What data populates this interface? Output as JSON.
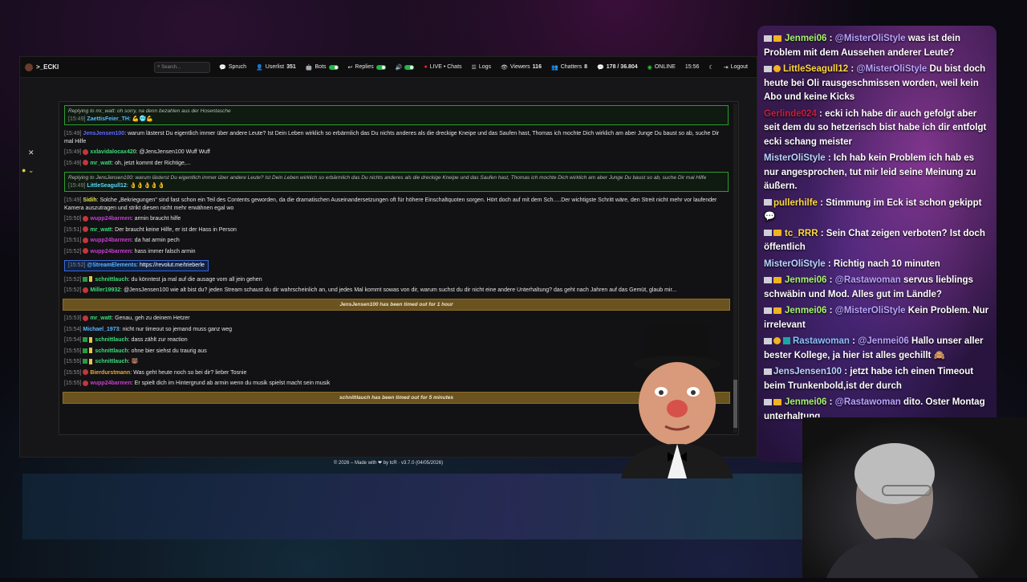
{
  "nav": {
    "brand": ">_ECKI",
    "search_placeholder": "Search...",
    "items": [
      {
        "label": "Spruch"
      },
      {
        "label": "Userlist",
        "count": "351"
      },
      {
        "label": "Bots"
      },
      {
        "label": "Replies"
      },
      {
        "label": "LIVE • Chats"
      },
      {
        "label": "Logs"
      },
      {
        "label": "Viewers",
        "count": "116"
      },
      {
        "label": "Chatters",
        "count": "8"
      },
      {
        "label": "178 / 36.804"
      },
      {
        "label": "ONLINE"
      },
      {
        "label": "15:56"
      },
      {
        "label": "Logout"
      }
    ]
  },
  "chat": [
    {
      "type": "reply",
      "ref": "Replying to mr_watt: oh sorry, na denn bezahlen aus der Hosentasche",
      "ts": "[15:49]",
      "user": "ZaettisFeier_TH",
      "user_color": "#58b8ff",
      "text": "💪🥶💪"
    },
    {
      "type": "msg",
      "ts": "[15:49]",
      "user": "JensJensen100",
      "user_color": "#5a6bff",
      "text": "warum lästerst Du eigentlich immer über andere Leute? Ist Dein Leben wirklich so erbärmlich das Du nichts anderes als die dreckige Kneipe und das Saufen hast, Thomas ich mochte Dich wirklich am aber Junge Du baust so ab, suche Dir mal Hilfe"
    },
    {
      "type": "msg",
      "ts": "[15:49]",
      "user": "xxlavidalocax420",
      "user_color": "#3ddc7a",
      "badge": true,
      "text": "@JensJensen100 Wuff Wuff"
    },
    {
      "type": "msg",
      "ts": "[15:49]",
      "user": "mr_watt",
      "user_color": "#3ddc7a",
      "badge": true,
      "text": "oh, jetzt kommt der Richtige,..."
    },
    {
      "type": "reply",
      "ref": "Replying to JensJensen100: warum lästerst Du eigentlich immer über andere Leute? Ist Dein Leben wirklich so erbärmlich das Du nichts anderes als die dreckige Kneipe und das Saufen hast, Thomas ich mochte Dich wirklich am aber Junge Du baust so ab, suche Dir mal Hilfe",
      "ts": "[15:49]",
      "user": "LittleSeagull12",
      "user_color": "#58d8ff",
      "text": "👌👌👌👌👌"
    },
    {
      "type": "msg",
      "ts": "[15:49]",
      "user": "Sidih",
      "user_color": "#e6e64a",
      "text": "Solche „Bekriegungen\" sind fast schon ein Teil des Contents geworden, da die dramatischen Auseinandersetzungen oft für höhere Einschaltquoten sorgen. Hört doch auf mit dem Sch.....Der wichtigste Schritt wäre, den Streit nicht mehr vor laufender Kamera auszutragen und strikt diesen nicht mehr erwähnen egal wo"
    },
    {
      "type": "msg",
      "ts": "[15:50]",
      "user": "wupp24barmen",
      "user_color": "#c43fd0",
      "badge": true,
      "text": "armin braucht hilfe"
    },
    {
      "type": "msg",
      "ts": "[15:51]",
      "user": "mr_watt",
      "user_color": "#3ddc7a",
      "badge": true,
      "text": "Der braucht keine Hilfe, er ist der Hass in Person"
    },
    {
      "type": "msg",
      "ts": "[15:51]",
      "user": "wupp24barmen",
      "user_color": "#c43fd0",
      "badge": true,
      "text": "da hat armin pech"
    },
    {
      "type": "msg",
      "ts": "[15:52]",
      "user": "wupp24barmen",
      "user_color": "#c43fd0",
      "badge": true,
      "text": "hass immer falsch armin"
    },
    {
      "type": "se",
      "ts": "[15:52]",
      "user": "@StreamElements",
      "user_color": "#58b8ff",
      "text": "https://revolut.me/trieberle"
    },
    {
      "type": "msg",
      "ts": "[15:52]",
      "user": "schnittlauch",
      "user_color": "#3ddc7a",
      "mod": true,
      "text": "du könntest ja mal auf die ausage vom all jein gehen"
    },
    {
      "type": "msg",
      "ts": "[15:52]",
      "user": "Miller19932",
      "user_color": "#3ddc7a",
      "badge": true,
      "text": "@JensJensen100 wie alt bist du? jeden Stream schaust du dir wahrscheinlich an, und jedes Mal kommt sowas von dir, warum suchst du dir nicht eine andere Unterhaltung? das geht nach Jahren auf das Gemüt, glaub mir..."
    },
    {
      "type": "timeout",
      "text": "JensJensen100 has been timed out for 1 hour"
    },
    {
      "type": "msg",
      "ts": "[15:53]",
      "user": "mr_watt",
      "user_color": "#3ddc7a",
      "badge": true,
      "text": "Genau, geh zu deinem Hetzer"
    },
    {
      "type": "msg",
      "ts": "[15:54]",
      "user": "Michael_1973",
      "user_color": "#58b8ff",
      "text": "nicht nur timeout so jemand muss ganz weg"
    },
    {
      "type": "msg",
      "ts": "[15:54]",
      "user": "schnittlauch",
      "user_color": "#3ddc7a",
      "mod": true,
      "text": "dass zählt zur reaction"
    },
    {
      "type": "msg",
      "ts": "[15:55]",
      "user": "schnittlauch",
      "user_color": "#3ddc7a",
      "mod": true,
      "text": "ohne bier siehst du traurig aus"
    },
    {
      "type": "msg",
      "ts": "[15:55]",
      "user": "schnittlauch",
      "user_color": "#3ddc7a",
      "mod": true,
      "text": "🐻"
    },
    {
      "type": "msg",
      "ts": "[15:55]",
      "user": "Bierdurstmann",
      "user_color": "#e6a83a",
      "badge": true,
      "text": "Was geht heute noch so bei dir? lieber Tosnie"
    },
    {
      "type": "msg",
      "ts": "[15:55]",
      "user": "wupp24barmen",
      "user_color": "#c43fd0",
      "badge": true,
      "text": "Er spielt dich im Hintergrund ab armin wenn du musik spielst macht sein musik"
    },
    {
      "type": "timeout",
      "text": "schnittlauch has been timed out for 5 minutes"
    }
  ],
  "footer": "© 2026 – Made with ❤ by tcR · v3.7.0 (04/05/2026)",
  "right_chat": [
    {
      "user": "Jenmei06",
      "cls": "name-green",
      "badges": "mc",
      "text_parts": [
        {
          "t": " : "
        },
        {
          "m": "@MisterOliStyle"
        },
        {
          "t": " was ist dein Problem mit dem Aussehen anderer Leute?"
        }
      ]
    },
    {
      "user": "LittleSeagull12",
      "cls": "name-yellow",
      "badges": "me",
      "text_parts": [
        {
          "t": " : "
        },
        {
          "m": "@MisterOliStyle"
        },
        {
          "t": " Du bist doch heute bei Oli rausgeschmissen worden, weil kein Abo und keine Kicks"
        }
      ]
    },
    {
      "user": "Gerlinde024",
      "cls": "name-red",
      "badges": "",
      "text_parts": [
        {
          "t": " : ecki ich habe dir auch gefolgt aber seit dem du so hetzerisch bist habe ich dir entfolgt ecki schang meister"
        }
      ]
    },
    {
      "user": "MisterOliStyle",
      "cls": "name-lb",
      "badges": "",
      "text_parts": [
        {
          "t": " : Ich hab kein Problem ich hab es nur angesprochen, tut mir leid seine Meinung zu äußern."
        }
      ]
    },
    {
      "user": "pullerhilfe",
      "cls": "name-yellow",
      "badges": "m",
      "text_parts": [
        {
          "t": " : Stimmung im Eck ist schon gekippt 💬"
        }
      ]
    },
    {
      "user": "tc_RRR",
      "cls": "name-yellow",
      "badges": "mc",
      "text_parts": [
        {
          "t": " : Sein Chat zeigen verboten? Ist doch öffentlich"
        }
      ]
    },
    {
      "user": "MisterOliStyle",
      "cls": "name-lb",
      "badges": "",
      "text_parts": [
        {
          "t": " : Richtig nach 10 minuten"
        }
      ]
    },
    {
      "user": "Jenmei06",
      "cls": "name-green",
      "badges": "mc",
      "text_parts": [
        {
          "t": " : "
        },
        {
          "m": "@Rastawoman"
        },
        {
          "t": " servus lieblings schwäbin und Mod. Alles gut im Ländle?"
        }
      ]
    },
    {
      "user": "Jenmei06",
      "cls": "name-green",
      "badges": "mc",
      "text_parts": [
        {
          "t": " : "
        },
        {
          "m": "@MisterOliStyle"
        },
        {
          "t": " Kein Problem. Nur irrelevant"
        }
      ]
    },
    {
      "user": "Rastawoman",
      "cls": "name-blue",
      "badges": "mes",
      "text_parts": [
        {
          "t": " : "
        },
        {
          "m": "@Jenmei06"
        },
        {
          "t": " Hallo unser aller bester Kollege, ja hier ist alles gechillt 🙈"
        }
      ]
    },
    {
      "user": "JensJensen100",
      "cls": "name-lb",
      "badges": "m",
      "text_parts": [
        {
          "t": " : jetzt habe ich einen Timeout beim Trunkenbold,ist der durch"
        }
      ]
    },
    {
      "user": "Jenmei06",
      "cls": "name-green",
      "badges": "mc",
      "text_parts": [
        {
          "t": " : "
        },
        {
          "m": "@Rastawoman"
        },
        {
          "t": " dito. Oster Montag unterhaltung"
        }
      ]
    }
  ]
}
